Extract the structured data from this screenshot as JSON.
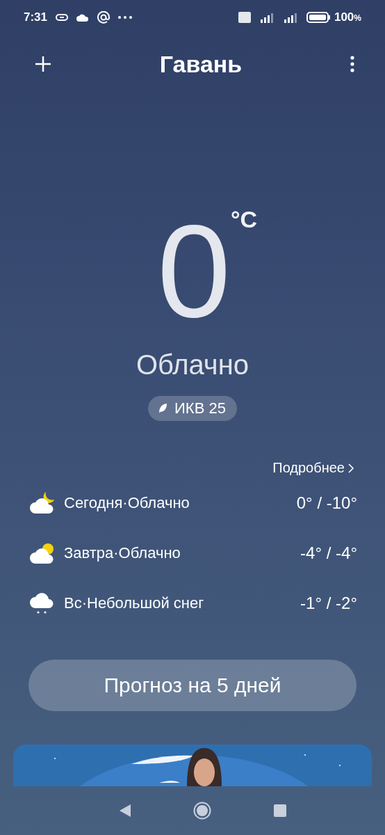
{
  "status_bar": {
    "time": "7:31",
    "battery": "100",
    "battery_unit": "%"
  },
  "header": {
    "city": "Гавань"
  },
  "current": {
    "temperature": "0",
    "unit": "°C",
    "condition": "Облачно",
    "aqi": "ИКВ 25"
  },
  "forecast": {
    "details_link": "Подробнее",
    "days": [
      {
        "kind": "cloud_moon",
        "label": "Сегодня·Облачно",
        "range": "0° / -10°"
      },
      {
        "kind": "cloud_sun",
        "label": "Завтра·Облачно",
        "range": "-4° / -4°"
      },
      {
        "kind": "snow",
        "label": "Вс·Небольшой снег",
        "range": "-1° / -2°"
      }
    ]
  },
  "five_day_button": "Прогноз на 5 дней"
}
